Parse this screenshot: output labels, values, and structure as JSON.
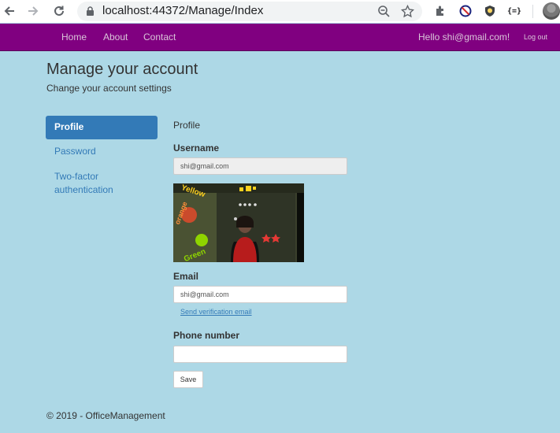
{
  "browser": {
    "url": "localhost:44372/Manage/Index"
  },
  "navbar": {
    "links": [
      "Home",
      "About",
      "Contact"
    ],
    "greeting": "Hello shi@gmail.com!",
    "logout": "Log out"
  },
  "page": {
    "title": "Manage your account",
    "subtitle": "Change your account settings"
  },
  "sidebar": {
    "items": [
      {
        "label": "Profile",
        "active": true
      },
      {
        "label": "Password",
        "active": false
      },
      {
        "label": "Two-factor authentication",
        "active": false
      }
    ]
  },
  "profile": {
    "section_label": "Profile",
    "username_label": "Username",
    "username_value": "shi@gmail.com",
    "photo_text": {
      "word1": "Yellow",
      "word2": "orange",
      "word3": "Green"
    },
    "email_label": "Email",
    "email_value": "shi@gmail.com",
    "send_verification": "Send verification email",
    "phone_label": "Phone number",
    "phone_value": "",
    "save_label": "Save"
  },
  "footer": {
    "text": "© 2019 - OfficeManagement"
  },
  "colors": {
    "navbar": "#800080",
    "page_bg": "#add8e6",
    "accent": "#337ab7"
  }
}
